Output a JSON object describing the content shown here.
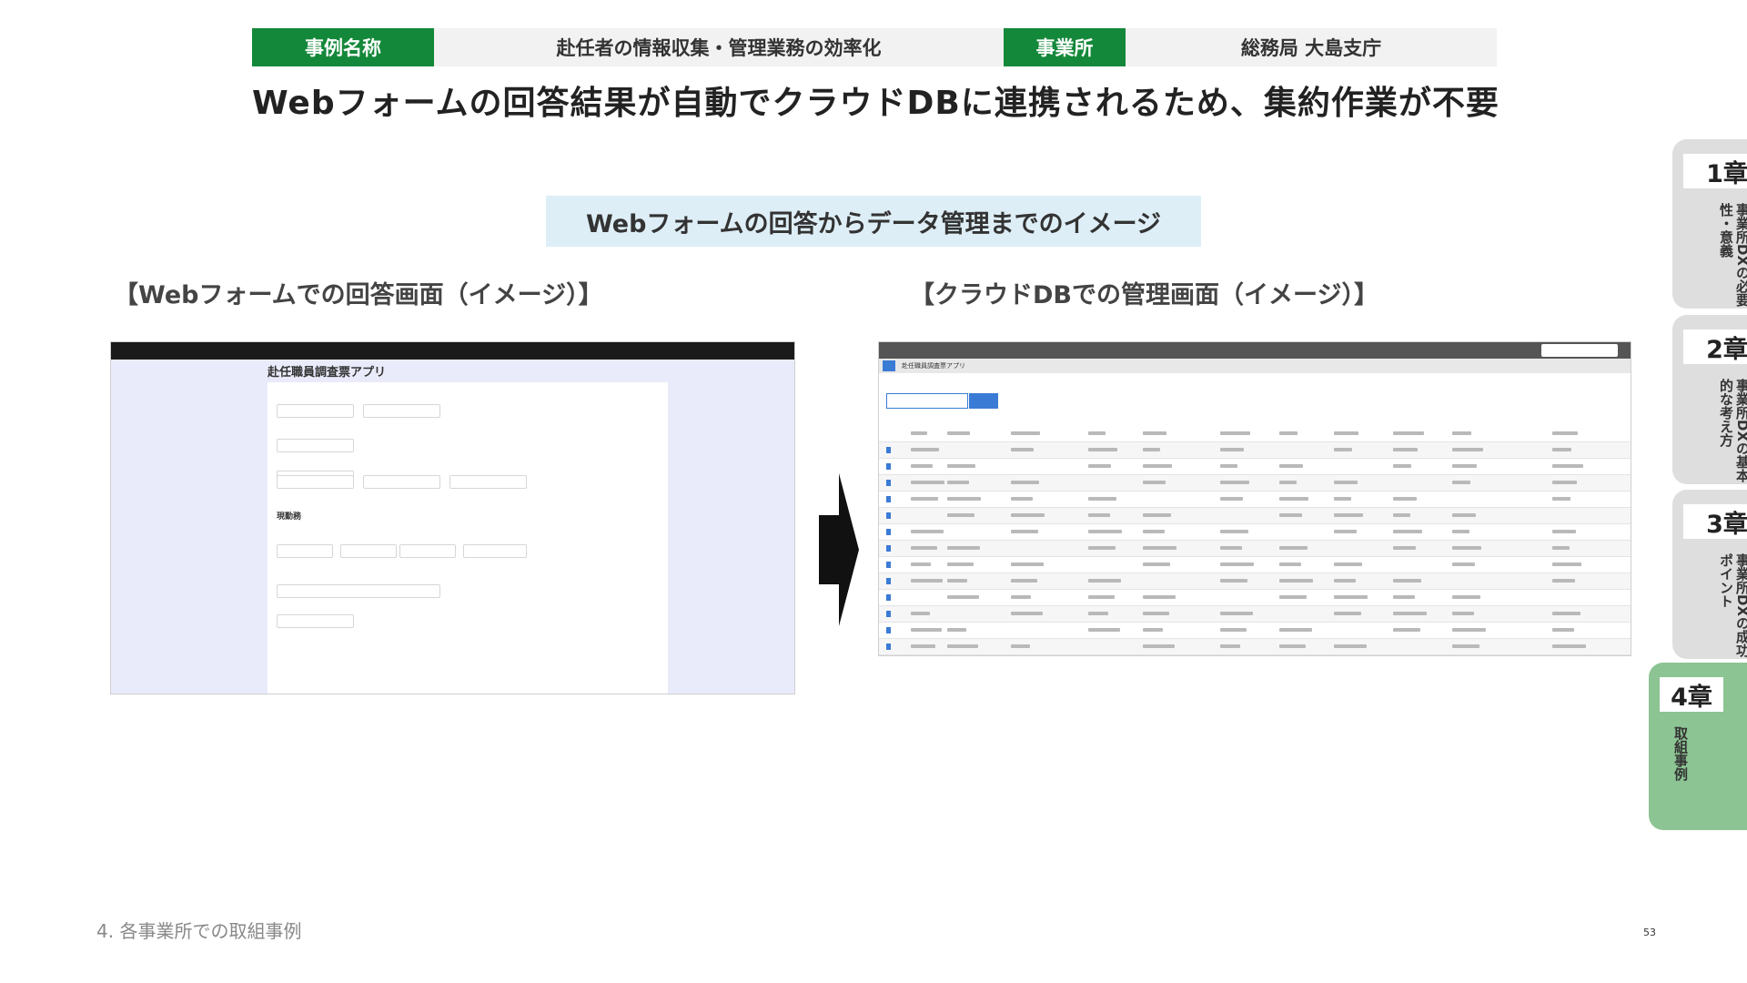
{
  "header": {
    "case_label": "事例名称",
    "case_value": "赴任者の情報収集・管理業務の効率化",
    "office_label": "事業所",
    "office_value": "総務局 大島支庁"
  },
  "headline": "Webフォームの回答結果が自動でクラウドDBに連携されるため、集約作業が不要",
  "image_caption": "Webフォームの回答からデータ管理までのイメージ",
  "panels": {
    "left_title": "【Webフォームでの回答画面（イメージ）】",
    "right_title": "【クラウドDBでの管理画面（イメージ）】"
  },
  "web_form": {
    "app_title": "赴任職員調査票アプリ",
    "section_title": "現勤務"
  },
  "cloud_db": {
    "app_title": "赴任職員調査票アプリ"
  },
  "chapters": [
    {
      "num": "1章",
      "desc": "事業所DXの必要性・意義"
    },
    {
      "num": "2章",
      "desc": "事業所DXの基本的な考え方"
    },
    {
      "num": "3章",
      "desc": "事業所DXの成功ポイント"
    },
    {
      "num": "4章",
      "desc": "取組事例"
    }
  ],
  "footer": "4. 各事業所での取組事例",
  "page_number": "53",
  "colors": {
    "accent_green": "#14883a",
    "active_tab": "#8cc493",
    "caption_bg": "#deeef6"
  }
}
